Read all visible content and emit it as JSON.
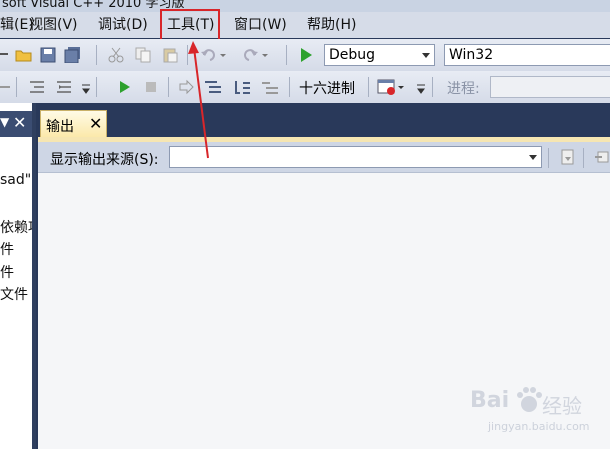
{
  "window": {
    "title_fragment": "soft Visual C++ 2010 学习版"
  },
  "menu": {
    "items": [
      {
        "label": "辑(E)"
      },
      {
        "label": "视图(V)"
      },
      {
        "label": "调试(D)"
      },
      {
        "label": "工具(T)"
      },
      {
        "label": "窗口(W)"
      },
      {
        "label": "帮助(H)"
      }
    ],
    "highlighted": "工具(T)",
    "highlight_color": "#d8262a"
  },
  "toolbar1": {
    "config_combo": {
      "value": "Debug"
    },
    "platform_combo": {
      "value": "Win32"
    }
  },
  "toolbar2": {
    "hex_label": "十六进制",
    "process_label": "进程:"
  },
  "left_panel": {
    "lines": [
      "sad\"(",
      "依赖项",
      "件",
      "件",
      "文件"
    ]
  },
  "output": {
    "tab_label": "输出",
    "tab_close": "✕",
    "show_output_from_label": "显示输出来源(S):",
    "source_value": ""
  },
  "watermark": {
    "brand": "Bai",
    "brand2": "经验",
    "url": "jingyan.baidu.com"
  },
  "icons": [
    "open-folder-icon",
    "save-icon",
    "save-all-icon",
    "cut-icon",
    "copy-icon",
    "paste-icon",
    "undo-icon",
    "redo-icon",
    "start-debug-icon",
    "stop-icon",
    "comment-icon",
    "uncomment-icon",
    "pin-icon",
    "close-icon"
  ],
  "colors": {
    "accent_red": "#d8262a",
    "frame_dark": "#29395a",
    "tab_gold": "#fbe8a8"
  }
}
